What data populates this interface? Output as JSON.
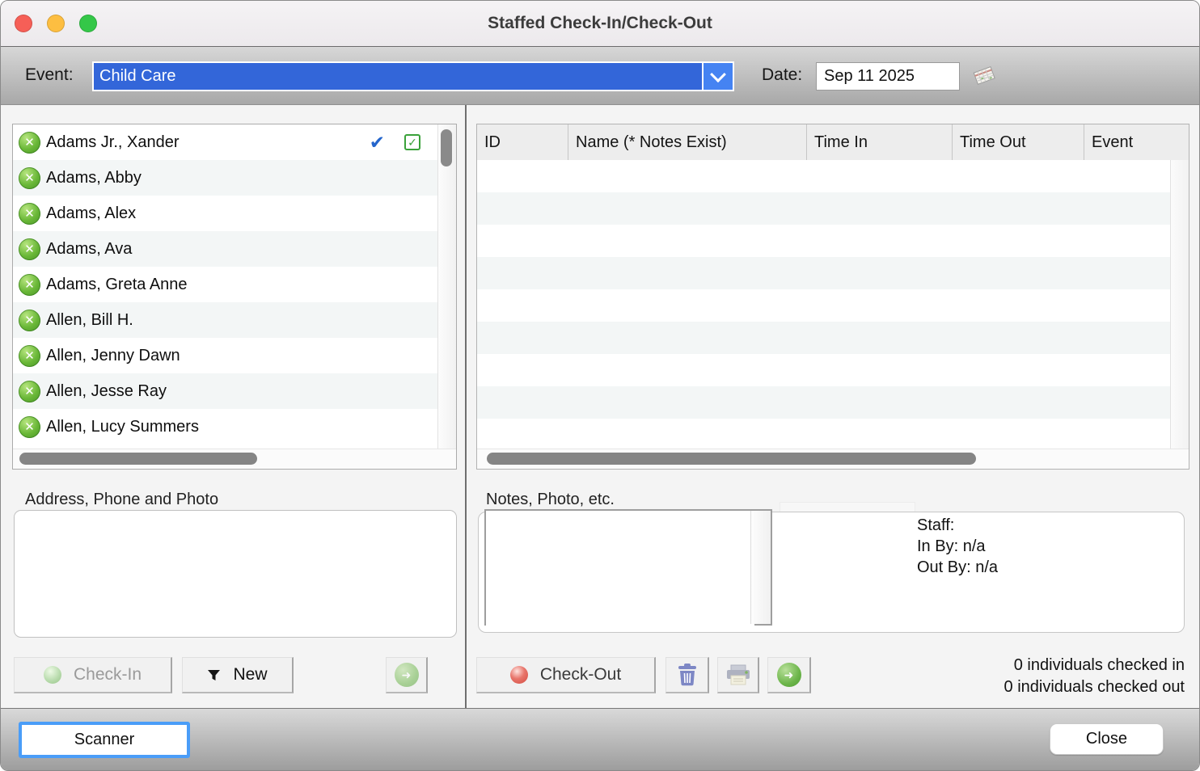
{
  "window": {
    "title": "Staffed Check-In/Check-Out"
  },
  "toolbar": {
    "event_label": "Event:",
    "event_value": "Child Care",
    "date_label": "Date:",
    "date_value": "Sep 11 2025"
  },
  "left_panel": {
    "people": [
      {
        "name": "Adams Jr., Xander",
        "checked": true
      },
      {
        "name": "Adams, Abby"
      },
      {
        "name": "Adams, Alex"
      },
      {
        "name": "Adams, Ava"
      },
      {
        "name": "Adams, Greta Anne"
      },
      {
        "name": "Allen, Bill H."
      },
      {
        "name": "Allen, Jenny Dawn"
      },
      {
        "name": "Allen, Jesse Ray"
      },
      {
        "name": "Allen, Lucy Summers"
      }
    ],
    "address_label": "Address, Phone and Photo",
    "checkin_label": "Check-In",
    "new_label": "New"
  },
  "right_panel": {
    "headers": [
      "ID",
      "Name (* Notes Exist)",
      "Time In",
      "Time Out",
      "Event"
    ],
    "notes_label": "Notes, Photo, etc.",
    "staff_label": "Staff:",
    "in_by": "In By: n/a",
    "out_by": "Out By: n/a",
    "checkout_label": "Check-Out",
    "checked_in": "0 individuals checked in",
    "checked_out": "0 individuals checked out"
  },
  "footer": {
    "scanner_label": "Scanner",
    "close_label": "Close"
  },
  "icons": {
    "event_dropdown": "chevron-down",
    "date_picker": "tilted-calendar",
    "person_status": "green-circle-x",
    "selected": "blue-checkmark",
    "attendance": "green-checkbox",
    "checkin": "pale-green-sphere",
    "checkout": "red-sphere",
    "new_filter": "funnel",
    "transfer": "green-arrow-circle",
    "delete": "trash-can",
    "print": "printer"
  },
  "colors": {
    "combo_blue": "#3366d9",
    "combo_arrow_blue": "#4583f2",
    "focus_ring_blue": "#4a9df8",
    "check_blue": "#2465cc",
    "checkbox_green": "#3aa23a",
    "checkin_sphere": "#b9dcae",
    "checkout_sphere": "#d44c41",
    "arrow_green": "#6cb54a",
    "traffic_red": "#f65f57",
    "traffic_yellow": "#fdbe41",
    "traffic_green": "#34c748"
  }
}
